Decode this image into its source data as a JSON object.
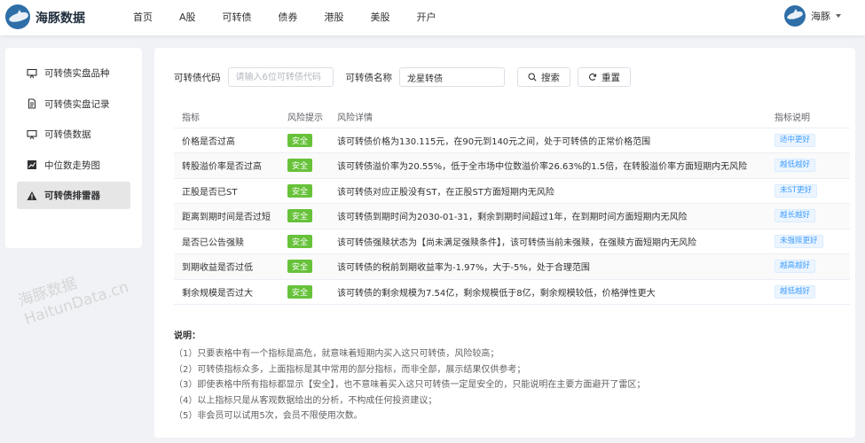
{
  "header": {
    "brand": "海豚数据",
    "nav": [
      "首页",
      "A股",
      "可转债",
      "债券",
      "港股",
      "美股",
      "开户"
    ],
    "user": "海豚"
  },
  "sidebar": {
    "items": [
      {
        "label": "可转债实盘品种",
        "icon": "monitor-icon"
      },
      {
        "label": "可转债实盘记录",
        "icon": "document-icon"
      },
      {
        "label": "可转债数据",
        "icon": "monitor-icon"
      },
      {
        "label": "中位数走势图",
        "icon": "chart-icon"
      },
      {
        "label": "可转债排雷器",
        "icon": "warning-icon",
        "active": true
      }
    ]
  },
  "search": {
    "code_label": "可转债代码",
    "code_placeholder": "请输入6位可转债代码",
    "code_value": "",
    "name_label": "可转债名称",
    "name_value": "龙星转债",
    "search_button": "搜索",
    "reset_button": "重置"
  },
  "table": {
    "headers": [
      "指标",
      "风险提示",
      "风险详情",
      "指标说明"
    ],
    "rows": [
      {
        "indicator": "价格是否过高",
        "risk": "安全",
        "detail": "该可转债价格为130.115元，在90元到140元之间，处于可转债的正常价格范围",
        "note": "适中更好"
      },
      {
        "indicator": "转股溢价率是否过高",
        "risk": "安全",
        "detail": "该可转债溢价率为20.55%，低于全市场中位数溢价率26.63%的1.5倍，在转股溢价率方面短期内无风险",
        "note": "越低越好"
      },
      {
        "indicator": "正股是否已ST",
        "risk": "安全",
        "detail": "该可转债对应正股没有ST，在正股ST方面短期内无风险",
        "note": "未ST更好"
      },
      {
        "indicator": "距离到期时间是否过短",
        "risk": "安全",
        "detail": "该可转债到期时间为2030-01-31，剩余到期时间超过1年，在到期时间方面短期内无风险",
        "note": "越长越好"
      },
      {
        "indicator": "是否已公告强赎",
        "risk": "安全",
        "detail": "该可转债强赎状态为【尚未满足强赎条件】，该可转债当前未强赎，在强赎方面短期内无风险",
        "note": "未强赎更好"
      },
      {
        "indicator": "到期收益是否过低",
        "risk": "安全",
        "detail": "该可转债的税前到期收益率为-1.97%，大于-5%，处于合理范围",
        "note": "越高越好"
      },
      {
        "indicator": "剩余规模是否过大",
        "risk": "安全",
        "detail": "该可转债的剩余规模为7.54亿，剩余规模低于8亿，剩余规模较低，价格弹性更大",
        "note": "越低越好"
      }
    ]
  },
  "notes": {
    "title": "说明：",
    "lines": [
      "（1）只要表格中有一个指标是高危，就意味着短期内买入这只可转债，风险较高；",
      "（2）可转债指标众多，上面指标是其中常用的部分指标，而非全部，展示结果仅供参考；",
      "（3）即使表格中所有指标都显示【安全】，也不意味着买入这只可转债一定是安全的，只能说明在主要方面避开了雷区；",
      "（4）以上指标只是从客观数据给出的分析，不构成任何投资建议；",
      "（5）非会员可以试用5次，会员不限使用次数。"
    ]
  },
  "watermark": {
    "line1": "海豚数据",
    "line2": "HaitunData.cn"
  },
  "colors": {
    "safe": "#67c23a",
    "note_text": "#409eff",
    "active_bg": "#e6e6e6"
  }
}
